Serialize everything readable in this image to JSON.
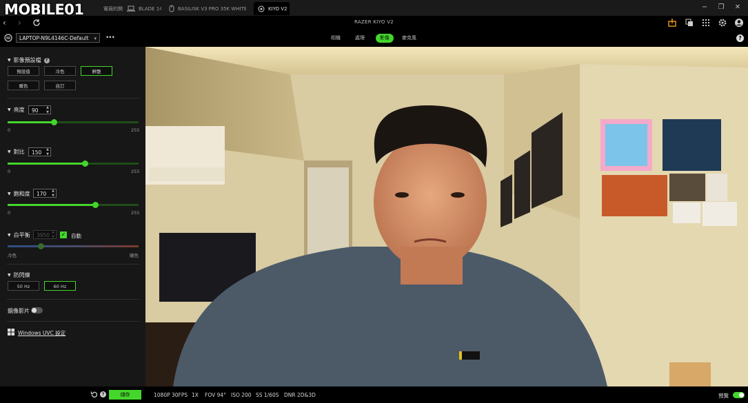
{
  "logo": {
    "text": "MOBILE01"
  },
  "tabs": [
    {
      "label": "電競的開啟",
      "icon": "razer-icon"
    },
    {
      "label": "BLADE 14",
      "icon": "laptop-icon"
    },
    {
      "label": "BASILISK V3 PRO 35K WHITE EDITI",
      "icon": "mouse-icon"
    },
    {
      "label": "KIYO V2",
      "icon": "webcam-icon",
      "active": true
    }
  ],
  "app_title": "RAZER KIYO V2",
  "device": {
    "selected": "LAPTOP-N9L4146C-Default"
  },
  "top_tabs": [
    {
      "label": "相機"
    },
    {
      "label": "處理"
    },
    {
      "label": "影像",
      "active": true
    },
    {
      "label": "麥克風"
    }
  ],
  "sidebar": {
    "preset": {
      "title": "影像預設檔",
      "buttons": [
        "預設值",
        "冷色",
        "鮮艷",
        "暖色",
        "自訂"
      ],
      "active": "鮮艷"
    },
    "brightness": {
      "label": "亮度",
      "value": "90",
      "min": "0",
      "max": "255",
      "fraction": 0.353
    },
    "contrast": {
      "label": "對比",
      "value": "150",
      "min": "0",
      "max": "255",
      "fraction": 0.588
    },
    "saturation": {
      "label": "飽和度",
      "value": "170",
      "min": "0",
      "max": "255",
      "fraction": 0.667
    },
    "white_balance": {
      "label": "白平衡",
      "value": "3950",
      "auto_label": "自動",
      "auto_checked": true,
      "min_label": "冷色",
      "max_label": "暖色",
      "fraction": 0.25
    },
    "antiflicker": {
      "title": "防閃爍",
      "options": [
        "50 Hz",
        "60 Hz"
      ],
      "active": "60 Hz"
    },
    "mirror": {
      "label": "鏡像影片",
      "enabled": false
    },
    "uvc_link": "Windows UVC 設定"
  },
  "bottom": {
    "save_label": "儲存",
    "stats": [
      "1080P 30FPS",
      "1X",
      "FOV 94°",
      "ISO 200",
      "SS 1/60S",
      "DNR 2D&3D"
    ],
    "preview_label": "預覽",
    "preview_on": true
  },
  "colors": {
    "accent": "#44d62c",
    "background": "#000000",
    "sidebar": "#171717"
  }
}
